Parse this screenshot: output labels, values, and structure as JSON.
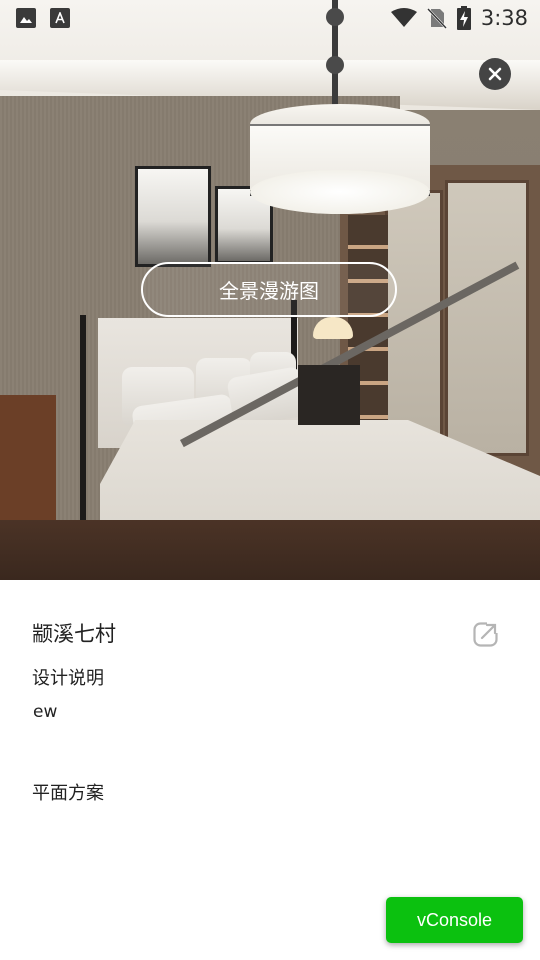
{
  "status_bar": {
    "time": "3:38",
    "left_icons": [
      "image-icon",
      "font-icon"
    ],
    "right_icons": [
      "wifi-icon",
      "no-sim-icon",
      "battery-charging-icon"
    ]
  },
  "hero": {
    "panorama_button_label": "全景漫游图",
    "close_icon": "close-icon"
  },
  "project": {
    "title": "颛溪七村",
    "design_notes_label": "设计说明",
    "design_notes_text": "ew",
    "floor_plan_label": "平面方案",
    "share_icon": "share-icon"
  },
  "vconsole": {
    "label": "vConsole",
    "color": "#0bc10f"
  }
}
